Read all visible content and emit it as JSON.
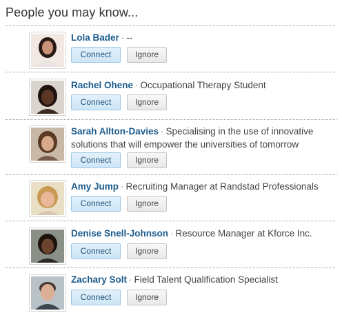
{
  "widget": {
    "title": "People you may know..."
  },
  "people": [
    {
      "name": "Lola Bader",
      "separator": "·",
      "headline": "--",
      "connect_label": "Connect",
      "ignore_label": "Ignore"
    },
    {
      "name": "Rachel Ohene",
      "separator": "·",
      "headline": "Occupational Therapy Student",
      "connect_label": "Connect",
      "ignore_label": "Ignore"
    },
    {
      "name": "Sarah Allton-Davies",
      "separator": "·",
      "headline": "Specialising in the use of innovative solutions that will empower the universities of tomorrow",
      "connect_label": "Connect",
      "ignore_label": "Ignore"
    },
    {
      "name": "Amy Jump",
      "separator": "·",
      "headline": "Recruiting Manager at Randstad Professionals",
      "connect_label": "Connect",
      "ignore_label": "Ignore"
    },
    {
      "name": "Denise Snell-Johnson",
      "separator": "·",
      "headline": "Resource Manager at Kforce Inc.",
      "connect_label": "Connect",
      "ignore_label": "Ignore"
    },
    {
      "name": "Zachary Solt",
      "separator": "·",
      "headline": "Field Talent Qualification Specialist",
      "connect_label": "Connect",
      "ignore_label": "Ignore"
    }
  ],
  "colors": {
    "name_link": "#1a5a8c",
    "connect_bg": "#d6eaf8",
    "divider": "#999999"
  }
}
